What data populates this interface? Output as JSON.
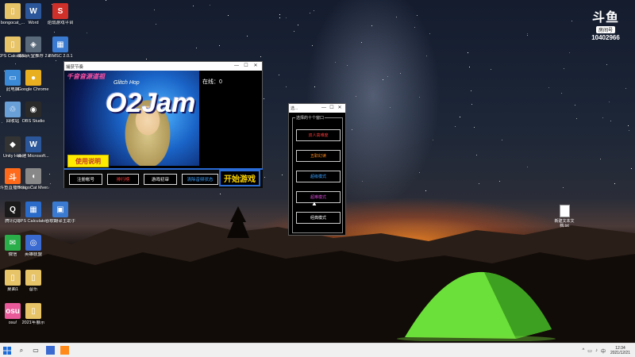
{
  "desktop": {
    "icons": [
      {
        "label": "bongocat_...",
        "glyph": "▯",
        "color": "#e8c468"
      },
      {
        "label": "Word",
        "glyph": "W",
        "color": "#2b579a"
      },
      {
        "label": "逆战游戏平台",
        "glyph": "S",
        "color": "#d0302a"
      },
      {
        "label": "XPS Calculator",
        "glyph": "▯",
        "color": "#e8c468"
      },
      {
        "label": "啸仙天堂推荐 2.exe",
        "glyph": "◈",
        "color": "#5a6a7a"
      },
      {
        "label": "IBMSC 2.0.1",
        "glyph": "▦",
        "color": "#3a7ad0"
      },
      {
        "label": "此电脑",
        "glyph": "▭",
        "color": "#3a8ad8"
      },
      {
        "label": "Google Chrome",
        "glyph": "●",
        "color": "#e8b020"
      },
      {
        "label": "回收站",
        "glyph": "♲",
        "color": "#6aa0d8"
      },
      {
        "label": "OBS Studio",
        "glyph": "◉",
        "color": "#2a2a2a"
      },
      {
        "label": "Unity Hub",
        "glyph": "◆",
        "color": "#333"
      },
      {
        "label": "新建 Microsoft...",
        "glyph": "W",
        "color": "#2b579a"
      },
      {
        "label": "斗鱼直播伴侣",
        "glyph": "斗",
        "color": "#ff6a1a"
      },
      {
        "label": "BongoCat Mver.exe",
        "glyph": "◖",
        "color": "#888"
      },
      {
        "label": "腾讯QQ",
        "glyph": "Q",
        "color": "#1a1a1a"
      },
      {
        "label": "XPS Calculator...",
        "glyph": "▦",
        "color": "#2a6ac8"
      },
      {
        "label": "谷歌翻译主助手",
        "glyph": "▣",
        "color": "#3a7ad0"
      },
      {
        "label": "微信",
        "glyph": "✉",
        "color": "#2aae4a"
      },
      {
        "label": "英雄联盟",
        "glyph": "◎",
        "color": "#3a6ad0"
      },
      {
        "label": "桌面1",
        "glyph": "▯",
        "color": "#e8c468"
      },
      {
        "label": "音乐",
        "glyph": "▯",
        "color": "#e8c468"
      },
      {
        "label": "osu!",
        "glyph": "osu",
        "color": "#e85a9a"
      },
      {
        "label": "2021年展示",
        "glyph": "▯",
        "color": "#e8c468"
      }
    ],
    "txt_file_label": "新建文本文档.txt"
  },
  "douyu": {
    "logo": "斗鱼",
    "tag": "房间号",
    "room": "10402966"
  },
  "main_window": {
    "title": "捕获节奏",
    "controls": [
      "—",
      "☐",
      "✕"
    ],
    "banner_title": "O2Jam",
    "banner_subtitle": "Glitch Hop",
    "banner_cn": "千音音源道祖",
    "online": "在线：0",
    "help_button": "使用说明",
    "buttons": [
      {
        "label": "注册帐号",
        "color": "#ffffff"
      },
      {
        "label": "排行榜",
        "color": "#ff3a3a"
      },
      {
        "label": "游戏初审",
        "color": "#ffffff"
      },
      {
        "label": "清除音频状态",
        "color": "#3aa0ff"
      }
    ],
    "start_button": "开始游戏"
  },
  "mode_window": {
    "title": "选...",
    "controls": [
      "—",
      "☐",
      "✕"
    ],
    "group_label": "选择的十个窗口",
    "buttons": [
      {
        "label": "双人高难度",
        "color": "#ff3a3a"
      },
      {
        "label": "五职幻读",
        "color": "#ff8a1a"
      },
      {
        "label": "超级模式",
        "color": "#3aa0ff"
      },
      {
        "label": "超难模式",
        "color": "#d04ad0"
      },
      {
        "label": "经典模式",
        "color": "#ffffff"
      }
    ]
  },
  "taskbar": {
    "start_icon": "windows-icon",
    "time": "12:34",
    "date": "2021/12/21",
    "tray_icons": [
      "^",
      "▭",
      "♪",
      "中"
    ]
  }
}
